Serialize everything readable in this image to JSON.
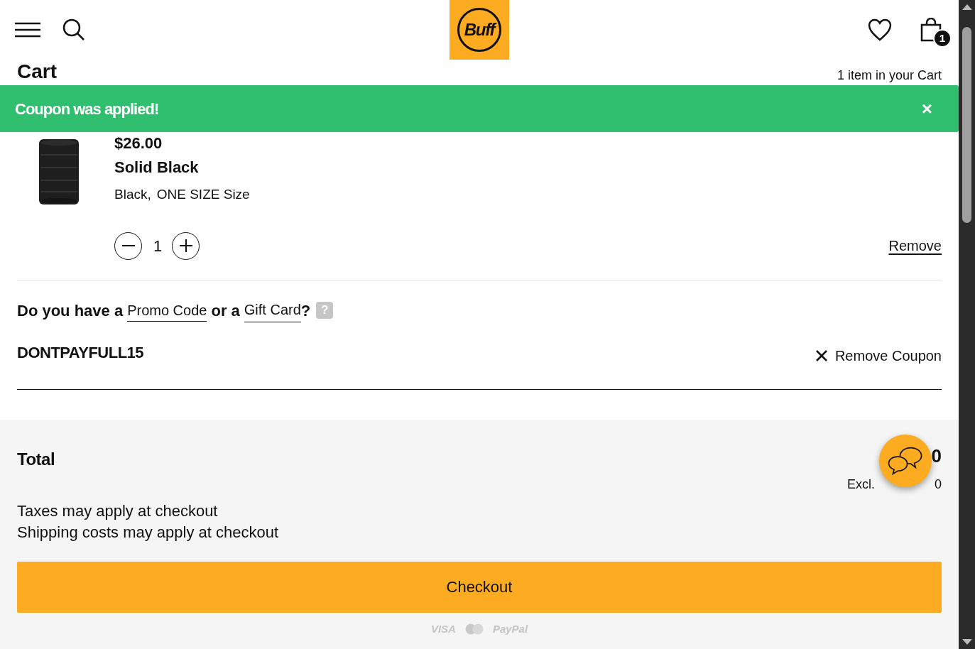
{
  "header": {
    "logo": "Buff",
    "cart_count": "1"
  },
  "cart": {
    "title": "Cart",
    "item_count": "1 item in your Cart"
  },
  "toast": {
    "message": "Coupon was applied!",
    "close": "×"
  },
  "item": {
    "price": "$26.00",
    "name": "Solid Black",
    "variant": "Black,",
    "size": "ONE SIZE Size",
    "quantity": "1",
    "remove": "Remove"
  },
  "promo": {
    "prefix": "Do you have a",
    "link_1": "Promo Code",
    "middle": "or a",
    "link_2": "Gift Card",
    "suffix": "?",
    "help": "?"
  },
  "coupon": {
    "code": "DONTPAYFULL15",
    "remove": "Remove Coupon"
  },
  "summary": {
    "total_label": "Total",
    "total_value": "0",
    "tax_prefix": "Excl.",
    "tax_value": "0",
    "notes": [
      "Taxes may apply at checkout",
      "Shipping costs may apply at checkout"
    ]
  },
  "checkout": "Checkout",
  "payments": [
    {
      "kind": "text",
      "label": "VISA"
    },
    {
      "kind": "circles"
    },
    {
      "kind": "text",
      "label": "PayPal"
    }
  ]
}
